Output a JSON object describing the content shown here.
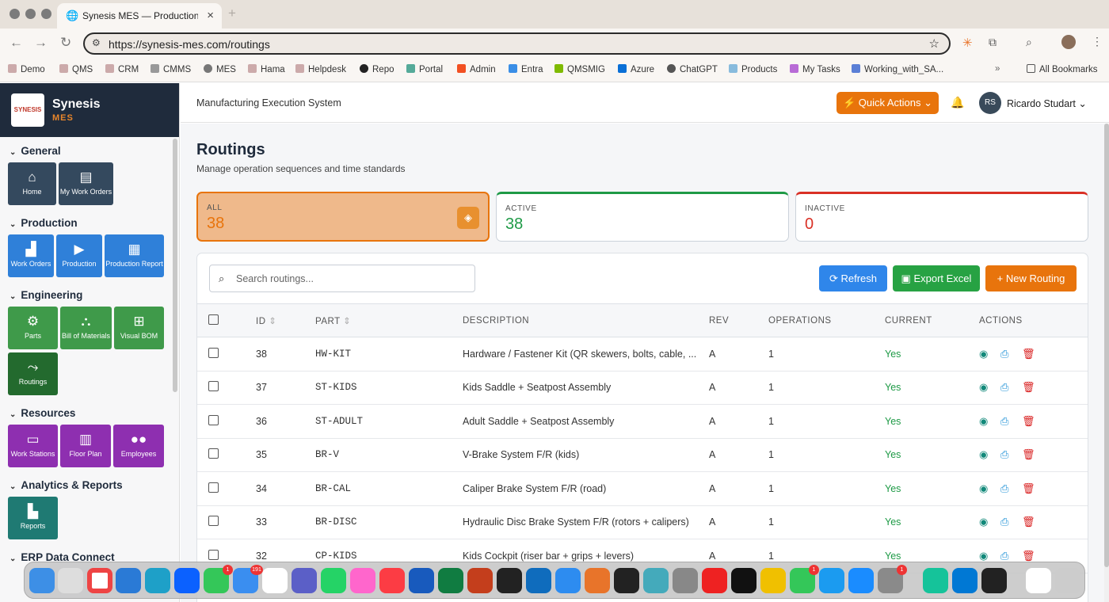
{
  "browser": {
    "tab_title": "Synesis MES — Production Tr",
    "url": "https://synesis-mes.com/routings",
    "bookmarks": [
      "Demo",
      "QMS",
      "CRM",
      "CMMS",
      "MES",
      "Hama",
      "Helpdesk",
      "Repo",
      "Portal",
      "Admin",
      "Entra",
      "QMSMIG",
      "Azure",
      "ChatGPT",
      "Products",
      "My Tasks",
      "Working_with_SA..."
    ],
    "all_bookmarks": "All Bookmarks"
  },
  "brand": {
    "logo_text": "SYNESIS",
    "name": "Synesis",
    "sub": "MES"
  },
  "sidebar": {
    "sections": [
      {
        "title": "General",
        "items": [
          "Home",
          "My Work Orders"
        ]
      },
      {
        "title": "Production",
        "items": [
          "Work Orders",
          "Production",
          "Production Report"
        ]
      },
      {
        "title": "Engineering",
        "items": [
          "Parts",
          "Bill of Materials",
          "Visual BOM",
          "Routings"
        ]
      },
      {
        "title": "Resources",
        "items": [
          "Work Stations",
          "Floor Plan",
          "Employees"
        ]
      },
      {
        "title": "Analytics & Reports",
        "items": [
          "Reports"
        ]
      },
      {
        "title": "ERP Data Connect",
        "items": []
      }
    ]
  },
  "topbar": {
    "app_title": "Manufacturing Execution System",
    "quick_actions": "Quick Actions",
    "avatar": "RS",
    "user_name": "Ricardo Studart"
  },
  "page": {
    "title": "Routings",
    "subtitle": "Manage operation sequences and time standards"
  },
  "stats": [
    {
      "label": "ALL",
      "value": "38",
      "color": "#e8740c"
    },
    {
      "label": "ACTIVE",
      "value": "38",
      "color": "#1e9a46"
    },
    {
      "label": "INACTIVE",
      "value": "0",
      "color": "#d93025"
    }
  ],
  "toolbar": {
    "search_placeholder": "Search routings...",
    "refresh": "Refresh",
    "export": "Export Excel",
    "new": "New Routing"
  },
  "table": {
    "headers": [
      "ID",
      "PART",
      "DESCRIPTION",
      "REV",
      "OPERATIONS",
      "CURRENT",
      "ACTIONS"
    ],
    "rows": [
      {
        "id": "38",
        "part": "HW-KIT",
        "desc": "Hardware / Fastener Kit (QR skewers, bolts, cable, ...",
        "rev": "A",
        "ops": "1",
        "current": "Yes"
      },
      {
        "id": "37",
        "part": "ST-KIDS",
        "desc": "Kids Saddle + Seatpost Assembly",
        "rev": "A",
        "ops": "1",
        "current": "Yes"
      },
      {
        "id": "36",
        "part": "ST-ADULT",
        "desc": "Adult Saddle + Seatpost Assembly",
        "rev": "A",
        "ops": "1",
        "current": "Yes"
      },
      {
        "id": "35",
        "part": "BR-V",
        "desc": "V-Brake System F/R (kids)",
        "rev": "A",
        "ops": "1",
        "current": "Yes"
      },
      {
        "id": "34",
        "part": "BR-CAL",
        "desc": "Caliper Brake System F/R (road)",
        "rev": "A",
        "ops": "1",
        "current": "Yes"
      },
      {
        "id": "33",
        "part": "BR-DISC",
        "desc": "Hydraulic Disc Brake System F/R (rotors + calipers)",
        "rev": "A",
        "ops": "1",
        "current": "Yes"
      },
      {
        "id": "32",
        "part": "CP-KIDS",
        "desc": "Kids Cockpit (riser bar + grips + levers)",
        "rev": "A",
        "ops": "1",
        "current": "Yes"
      }
    ]
  },
  "dock": {
    "badges": {
      "messages": "1",
      "mail": "191",
      "facetime": "1",
      "settings": "1"
    }
  }
}
